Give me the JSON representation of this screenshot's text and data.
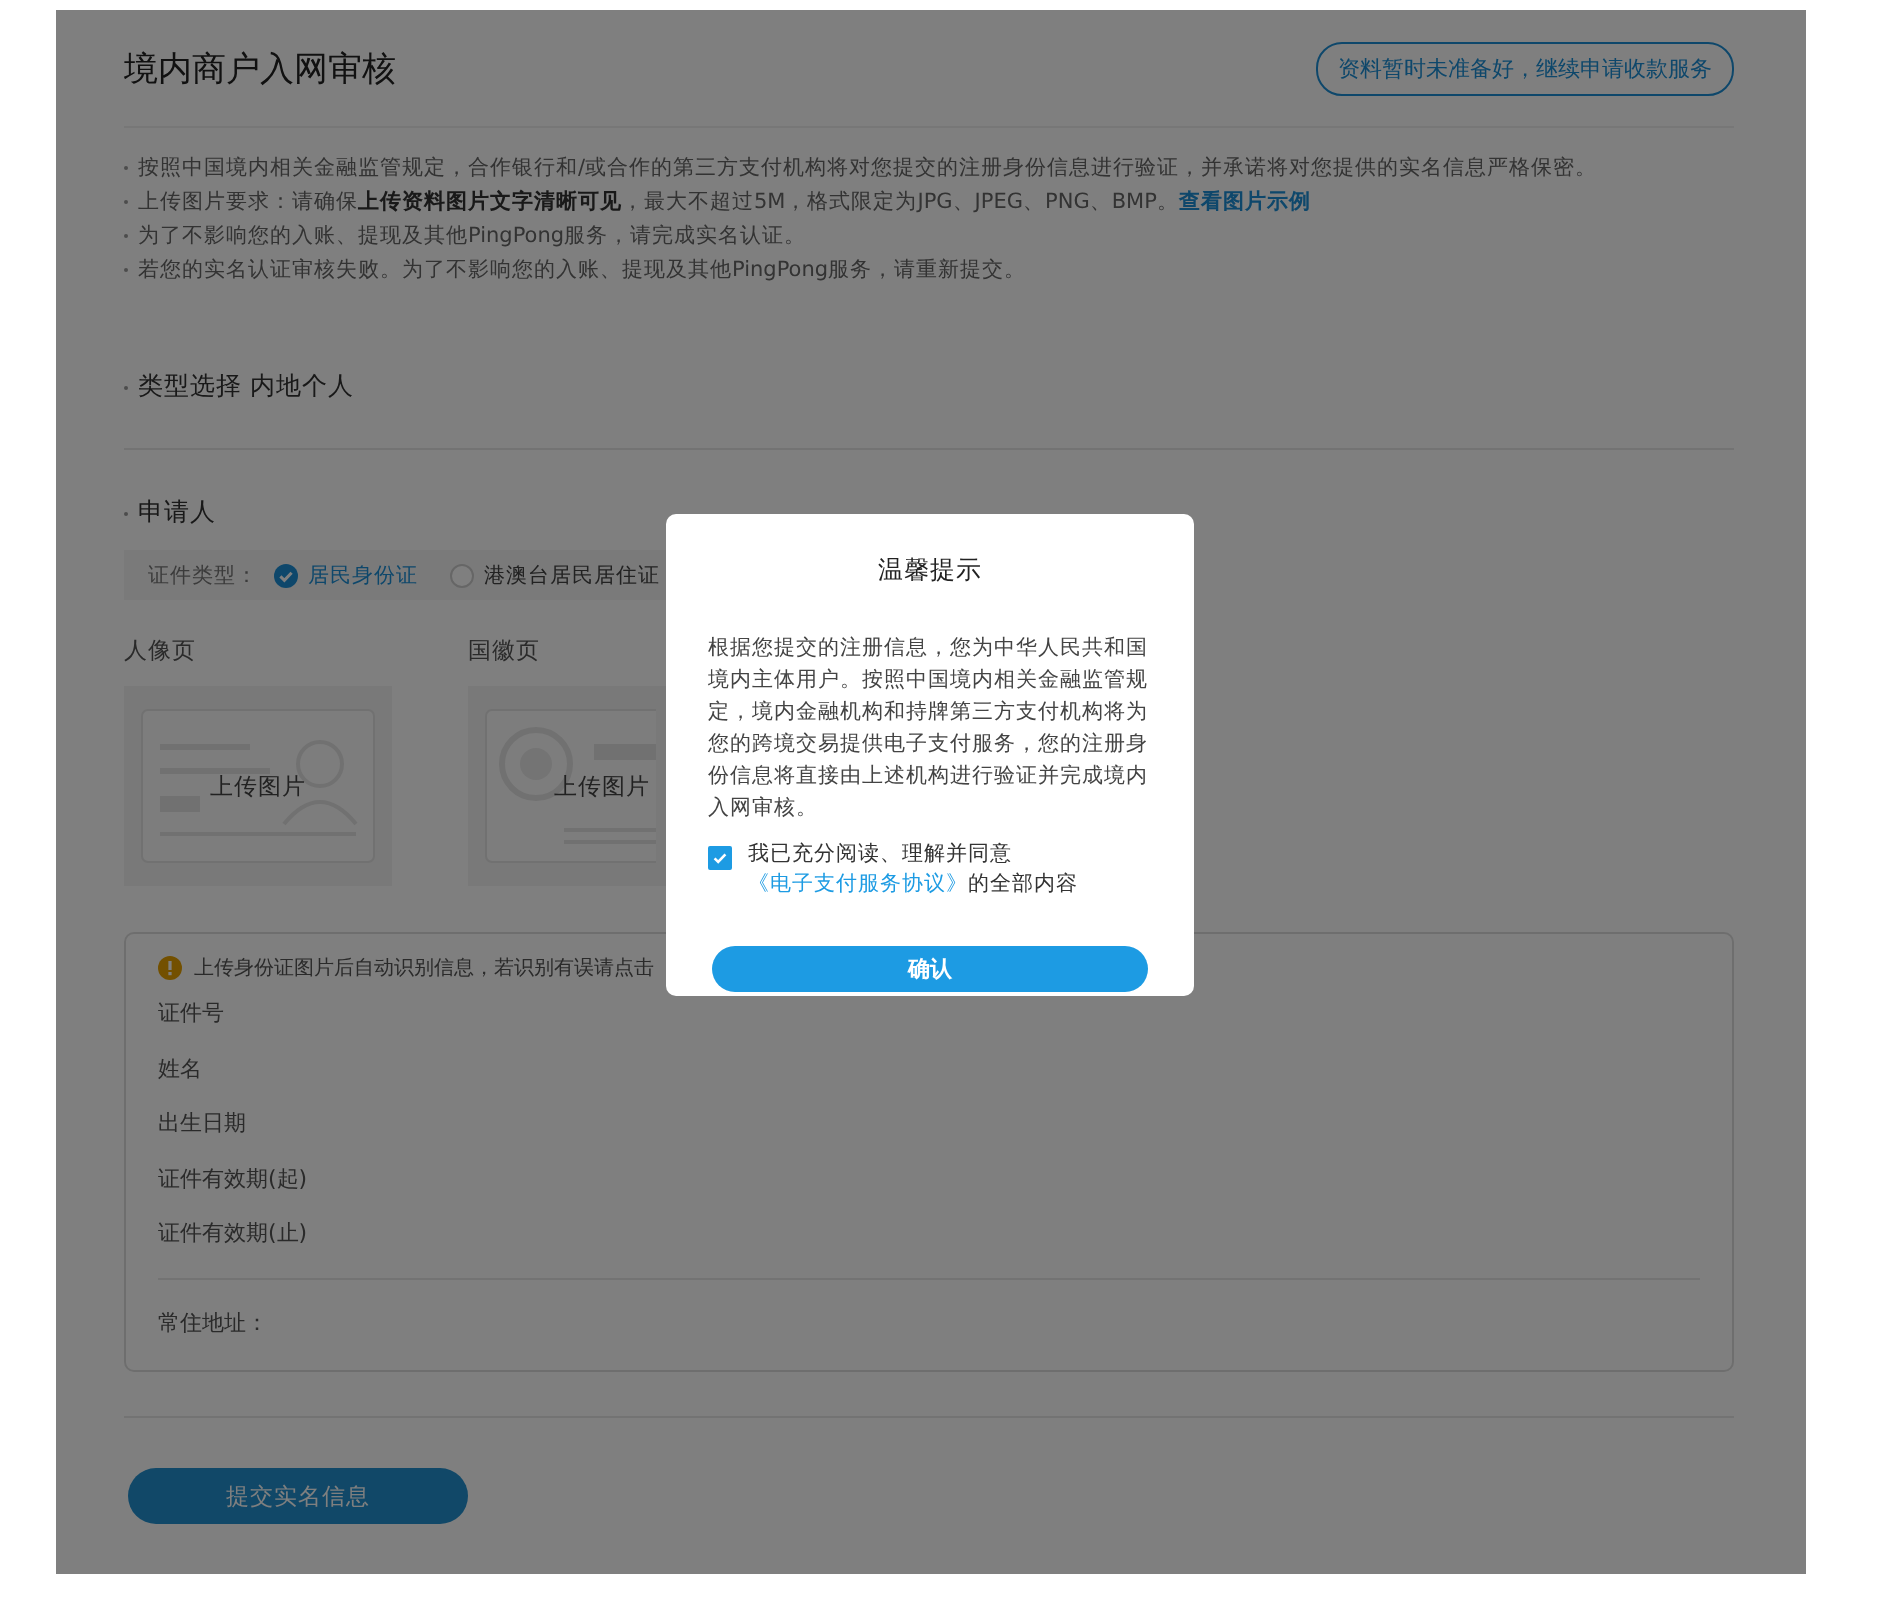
{
  "header": {
    "title": "境内商户入网审核",
    "continue_button": "资料暂时未准备好，继续申请收款服务"
  },
  "notes": [
    {
      "text": "按照中国境内相关金融监管规定，合作银行和/或合作的第三方支付机构将对您提交的注册身份信息进行验证，并承诺将对您提供的实名信息严格保密。"
    },
    {
      "text": "上传图片要求：请确保**上传资料图片文字清晰可见**，最大不超过5M，格式限定为JPG、JPEG、PNG、BMP。",
      "link": "查看图片示例"
    },
    {
      "text": "为了不影响您的入账、提现及其他PingPong服务，请完成实名认证。"
    },
    {
      "text": "若您的实名认证审核失败。为了不影响您的入账、提现及其他PingPong服务，请重新提交。"
    }
  ],
  "type_selection": {
    "label": "类型选择",
    "value": "内地个人"
  },
  "applicant": {
    "title": "申请人",
    "id_type_label": "证件类型：",
    "id_types": [
      {
        "label": "居民身份证",
        "selected": true
      },
      {
        "label": "港澳台居民居住证",
        "selected": false
      }
    ],
    "uploads": [
      {
        "label": "人像页",
        "button": "上传图片",
        "kind": "portrait"
      },
      {
        "label": "国徽页",
        "button": "上传图片",
        "kind": "emblem"
      }
    ]
  },
  "info": {
    "warning": "上传身份证图片后自动识别信息，若识别有误请点击",
    "fields": [
      "证件号",
      "姓名",
      "出生日期",
      "证件有效期(起)",
      "证件有效期(止)"
    ],
    "address_label": "常住地址："
  },
  "submit_button": "提交实名信息",
  "dialog": {
    "title": "温馨提示",
    "body": "根据您提交的注册信息，您为中华人民共和国境内主体用户。按照中国境内相关金融监管规定，境内金融机构和持牌第三方支付机构将为您的跨境交易提供电子支付服务，您的注册身份信息将直接由上述机构进行验证并完成境内入网审核。",
    "agree": {
      "checked": true,
      "text": "我已充分阅读、理解并同意",
      "link": "《电子支付服务协议》",
      "suffix": "的全部内容"
    },
    "confirm_button": "确认"
  }
}
